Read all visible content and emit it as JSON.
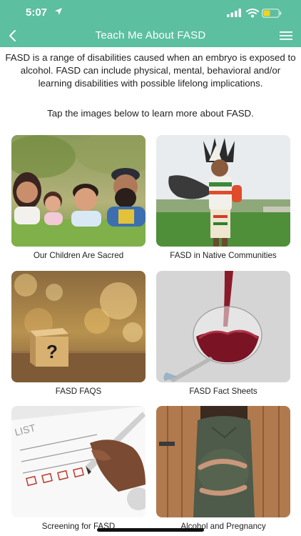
{
  "status": {
    "time": "5:07"
  },
  "nav": {
    "title": "Teach Me About FASD"
  },
  "intro": {
    "paragraph": "FASD is a range of disabilities caused when an embryo is exposed to alcohol. FASD can include physical, mental, behavioral and/or learning disabilities with possible lifelong implications.",
    "tap_instruction": "Tap the images below to learn more about FASD."
  },
  "cards": [
    {
      "label": "Our Children Are Sacred",
      "icon": "family-photo"
    },
    {
      "label": "FASD in Native Communities",
      "icon": "native-dancer-photo"
    },
    {
      "label": "FASD FAQS",
      "icon": "question-block-photo"
    },
    {
      "label": "FASD Fact Sheets",
      "icon": "wine-glass-photo"
    },
    {
      "label": "Screening for FASD",
      "icon": "checklist-photo"
    },
    {
      "label": "Alcohol and Pregnancy",
      "icon": "pregnant-woman-photo"
    }
  ],
  "colors": {
    "header": "#5cbfa0",
    "battery": "#f5d21f"
  }
}
